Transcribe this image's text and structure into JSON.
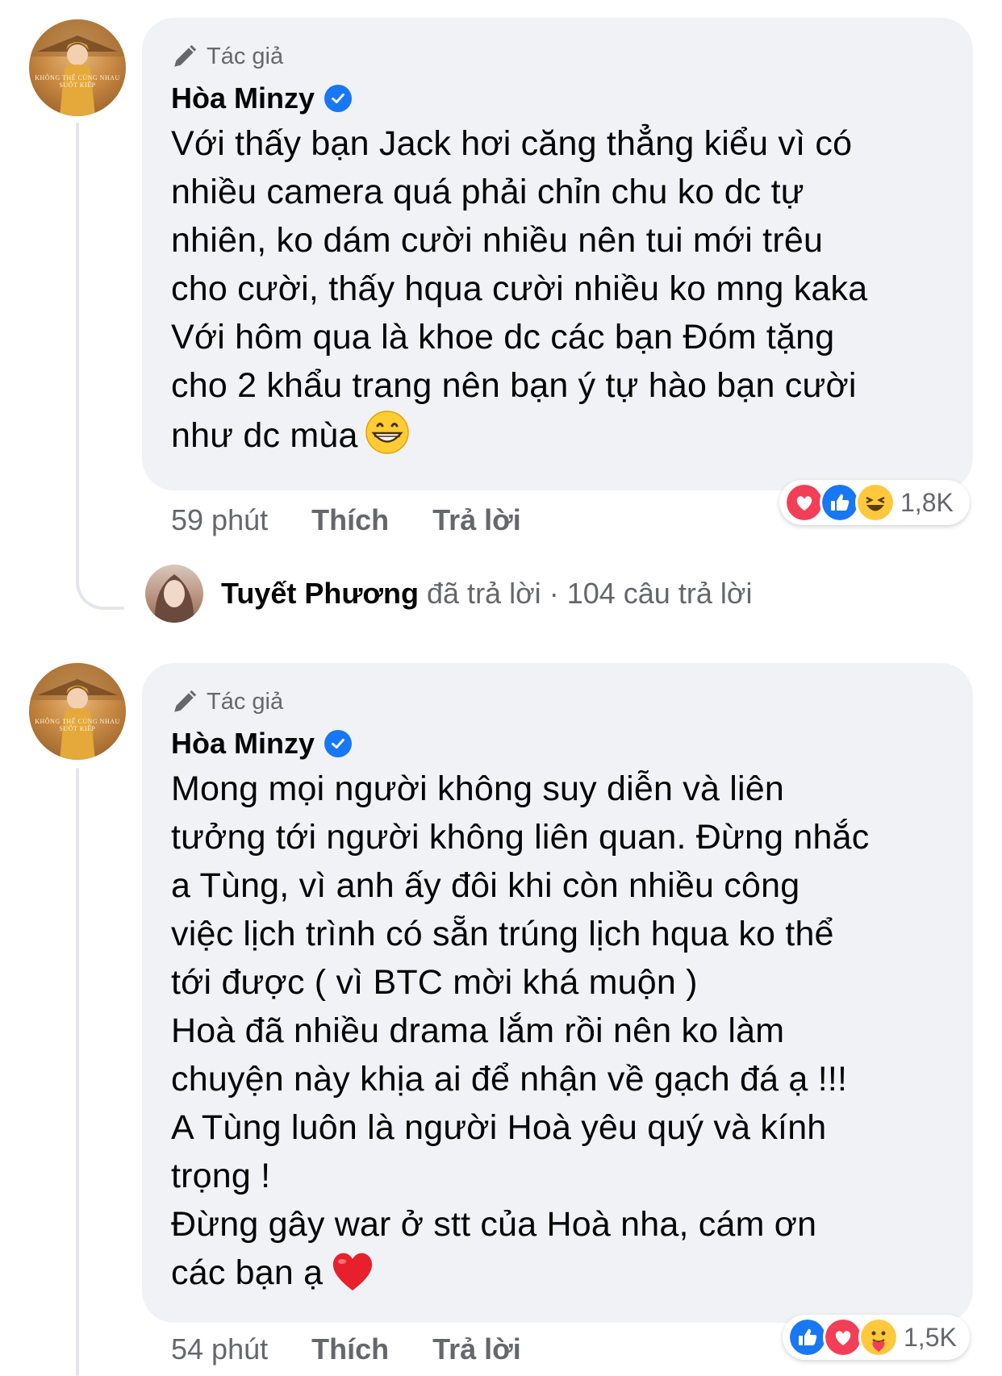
{
  "comments": [
    {
      "badge": "Tác giả",
      "author": "Hòa Minzy",
      "avatar_poster_title": "KHÔNG THỂ CÙNG NHAU SUỐT KIẾP",
      "text": "Với thấy bạn Jack hơi căng thẳng kiểu vì có\nnhiều camera quá phải chỉn chu ko dc tự\nnhiên, ko dám cười nhiều nên tui mới trêu\ncho cười, thấy hqua cười nhiều ko mng kaka\nVới hôm qua là khoe dc các bạn Đóm tặng\ncho 2 khẩu trang nên bạn ý tự hào bạn cười\nnhư dc mùa",
      "emoji": "grinning-face",
      "time": "59 phút",
      "like": "Thích",
      "reply": "Trả lời",
      "reaction_icons": [
        "love",
        "like",
        "haha"
      ],
      "reaction_count": "1,8K"
    },
    {
      "badge": "Tác giả",
      "author": "Hòa Minzy",
      "avatar_poster_title": "KHÔNG THỂ CÙNG NHAU SUỐT KIẾP",
      "text": "Mong mọi người không suy diễn và liên\ntưởng tới người không liên quan. Đừng nhắc\na Tùng, vì anh ấy đôi khi còn nhiều công\nviệc lịch trình có sẵn trúng lịch hqua ko thể\ntới được ( vì BTC mời khá muộn )\nHoà đã nhiều drama lắm rồi nên ko làm\nchuyện này khịa ai để nhận về gạch đá ạ !!!\nA Tùng luôn là người Hoà yêu quý và kính\ntrọng !\nĐừng gây war ở stt của Hoà nha, cám ơn\ncác bạn ạ",
      "emoji": "red-heart",
      "time": "54 phút",
      "like": "Thích",
      "reply": "Trả lời",
      "reaction_icons": [
        "like",
        "love",
        "care"
      ],
      "reaction_count": "1,5K"
    }
  ],
  "reply_summary": {
    "name": "Tuyết Phương",
    "action": "đã trả lời",
    "separator": "·",
    "count": "104 câu trả lời"
  },
  "colors": {
    "bubble": "#f0f2f5",
    "secondary_text": "#65676b",
    "verified": "#1877f2",
    "like": "#1877f2",
    "love": "#f33e58"
  }
}
